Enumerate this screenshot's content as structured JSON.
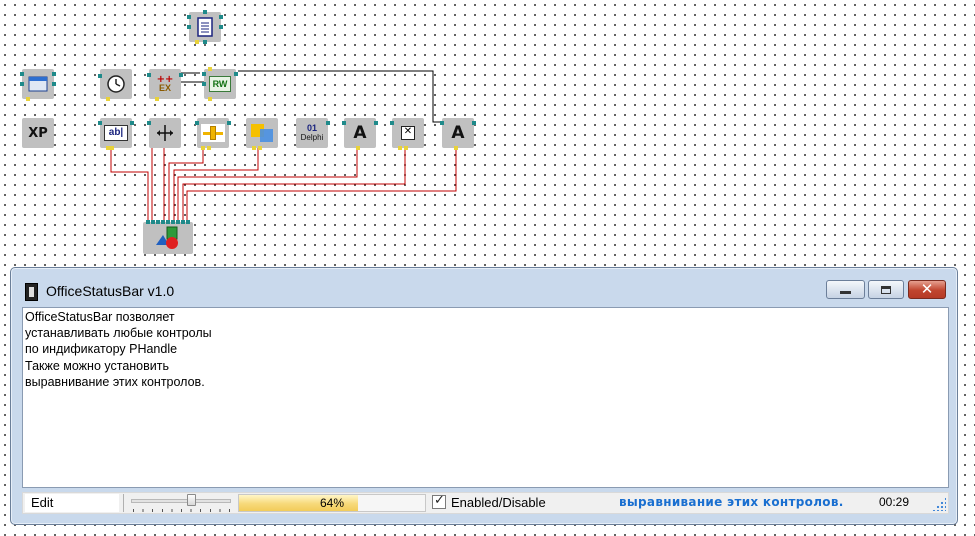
{
  "window": {
    "title": "OfficeStatusBar v1.0",
    "description_lines": [
      "OfficeStatusBar позволяет",
      "устанавливать любые контролы",
      "по индификатору PHandle",
      "Также можно установить",
      "выравнивание этих контролов."
    ],
    "buttons": {
      "minimize": "minimize",
      "maximize": "maximize",
      "close": "close"
    }
  },
  "statusbar": {
    "edit_value": "Edit",
    "slider_level": 0.62,
    "progress_percent": 64,
    "progress_text": "64%",
    "checkbox_checked": true,
    "checkbox_label": "Enabled/Disable",
    "message": "выравнивание этих контролов.",
    "time": "00:29"
  },
  "components": {
    "xp_label": "XP",
    "edit_label": "ab|",
    "ex_label": "EX",
    "rw_label": "RW",
    "delphi_label": "Delphi",
    "delphi_digits": "01",
    "a_label": "A",
    "icons": [
      "document-icon",
      "form-icon",
      "clock-icon",
      "exception-icon",
      "read-write-icon",
      "xp-style-icon",
      "edit-box-icon",
      "position-icon",
      "slider-icon",
      "color-icon",
      "delphi-icon",
      "label-icon",
      "checkbox-icon",
      "label-icon",
      "status-bar-icon"
    ]
  },
  "colors": {
    "wire_black": "#000000",
    "wire_red": "#c00000",
    "pin_teal": "#1f8a8a",
    "pin_yellow": "#e8d23a",
    "status_message": "#1a6fd0",
    "close_button": "#c0452e"
  }
}
